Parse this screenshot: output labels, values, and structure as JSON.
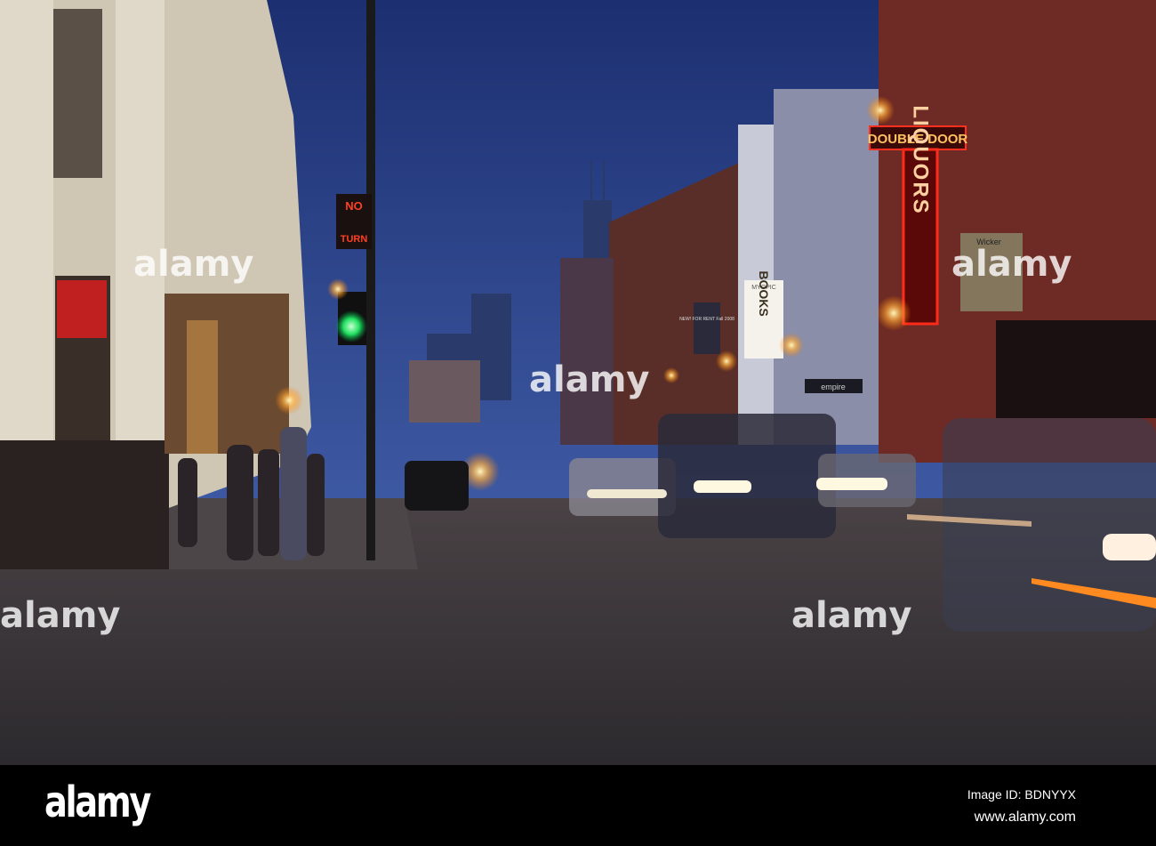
{
  "photo": {
    "signs": {
      "double_door": "DOUBLE DOOR",
      "liquors": "LIQUORS",
      "myopic": "MYOPIC",
      "books": "BOOKS",
      "for_rent": "NEW! FOR RENT Fall 2008",
      "empire": "empire",
      "wicker": "Wicker",
      "no_turn_top": "NO",
      "no_turn_bottom": "TURN"
    },
    "watermark": "alamy",
    "watermark_letter": "a"
  },
  "footer": {
    "logo": "alamy",
    "image_id": "Image ID: BDNYYX",
    "website": "www.alamy.com"
  },
  "colors": {
    "sky_top": "#1c2f70",
    "sky_bottom": "#4a6ab8",
    "neon_red": "#ff2a1a",
    "road": "#3a3536"
  }
}
